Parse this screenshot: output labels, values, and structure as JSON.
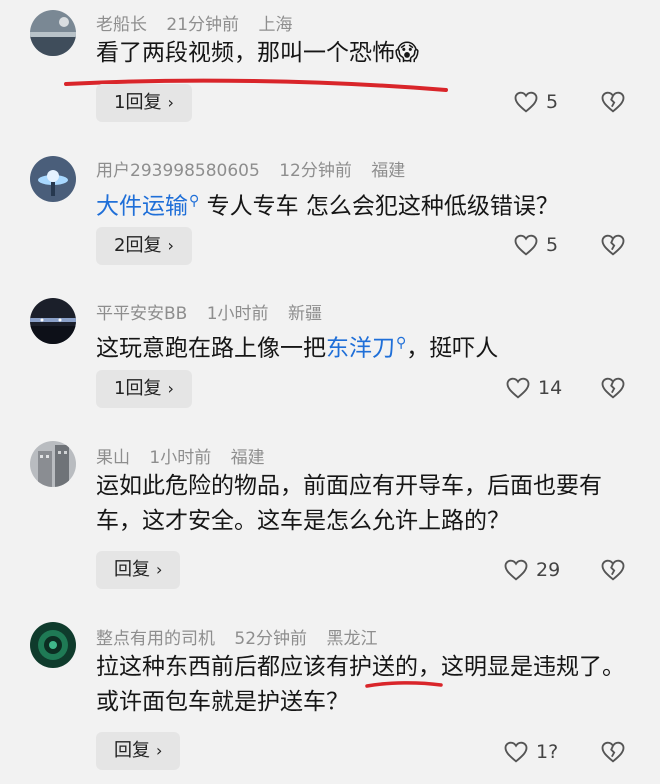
{
  "comments": [
    {
      "user": "老船长",
      "time": "21分钟前",
      "location": "上海",
      "text_plain": "看了两段视频，那叫一个恐怖",
      "emoji": "😱",
      "reply": "1回复",
      "likes": "5"
    },
    {
      "user": "用户293998580605",
      "time": "12分钟前",
      "location": "福建",
      "link": "大件运输",
      "text_rest": " 专人专车 怎么会犯这种低级错误？",
      "reply": "2回复",
      "likes": "5"
    },
    {
      "user": "平平安安BB",
      "time": "1小时前",
      "location": "新疆",
      "text_before": "这玩意跑在路上像一把",
      "link": "东洋刀",
      "text_after": "，挺吓人",
      "reply": "1回复",
      "likes": "14"
    },
    {
      "user": "果山",
      "time": "1小时前",
      "location": "福建",
      "text_plain": "运如此危险的物品，前面应有开导车，后面也要有车，这才安全。这车是怎么允许上路的？",
      "reply": "回复",
      "likes": "29"
    },
    {
      "user": "整点有用的司机",
      "time": "52分钟前",
      "location": "黑龙江",
      "text_plain": "拉这种东西前后都应该有护送的，这明显是违规了。或许面包车就是护送车？",
      "reply": "回复",
      "likes": "1?"
    }
  ],
  "icons": {
    "like": "heart-outline-icon",
    "dislike": "broken-heart-icon",
    "search": "search-icon",
    "chevron": "chevron-right-icon"
  },
  "colors": {
    "link": "#1f6fd8",
    "annotation": "#d9252a",
    "background": "#f2f2f2"
  }
}
